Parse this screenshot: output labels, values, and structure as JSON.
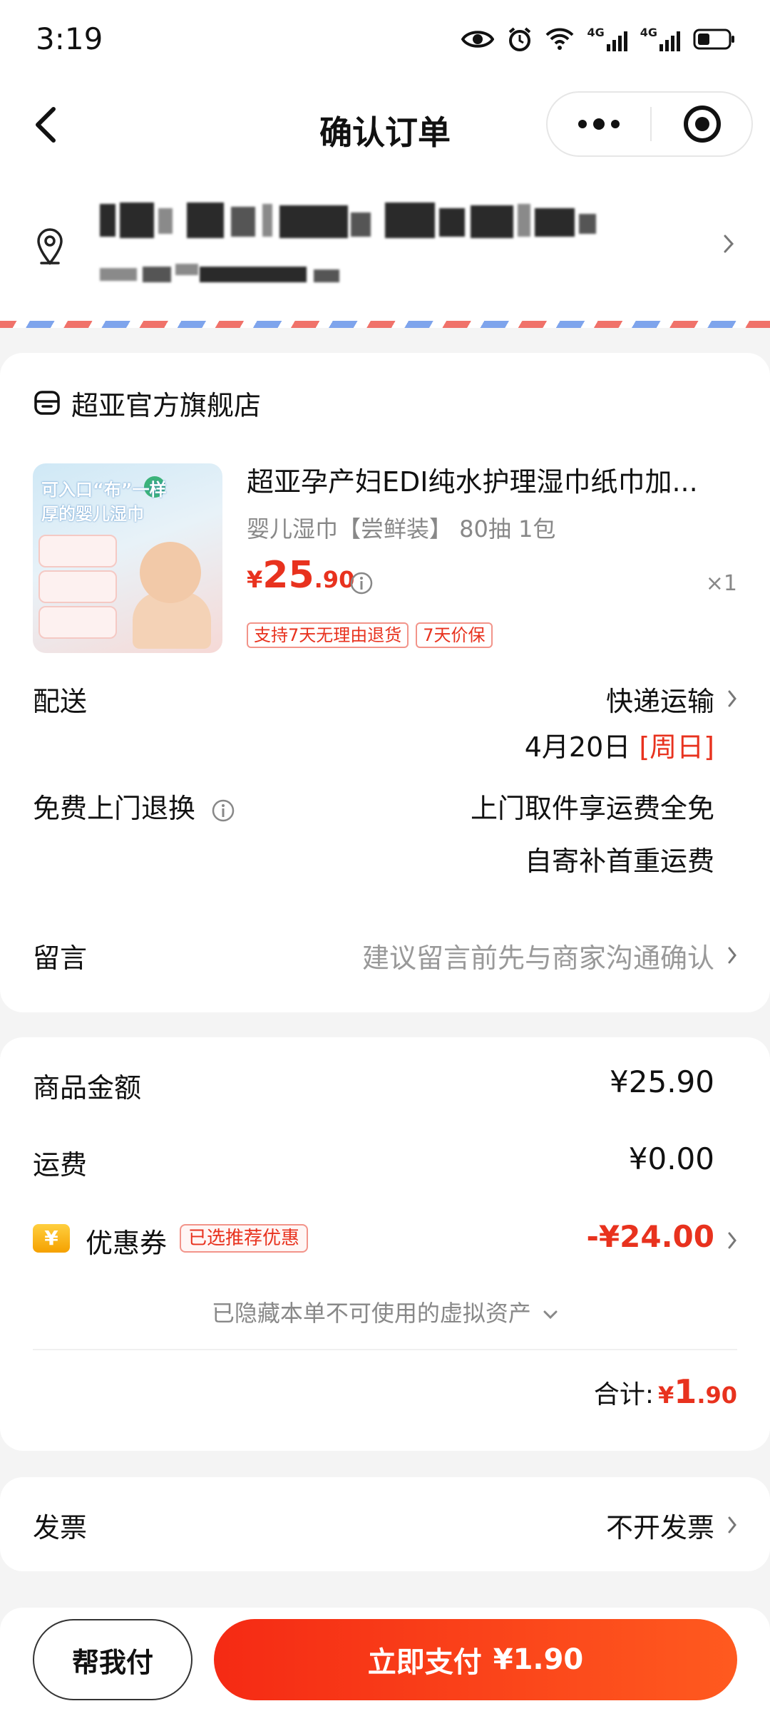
{
  "status_bar": {
    "time": "3:19",
    "net1": "4G",
    "net2": "4G"
  },
  "nav": {
    "title": "确认订单"
  },
  "shop": {
    "name": "超亚官方旗舰店"
  },
  "product": {
    "image_text_1": "可入口“布”一样",
    "image_text_2": "厚的婴儿湿巾",
    "title": "超亚孕产妇EDI纯水护理湿巾纸巾加...",
    "spec": "婴儿湿巾【尝鲜装】 80抽 1包",
    "price_yen": "¥",
    "price_int": "25",
    "price_dec": ".90",
    "qty": "×1",
    "tags": [
      "支持7天无理由退货",
      "7天价保"
    ]
  },
  "delivery": {
    "label": "配送",
    "method": "快递运输",
    "date": "4月20日",
    "weekday": "[周日]"
  },
  "return_service": {
    "label": "免费上门退换",
    "line1": "上门取件享运费全免",
    "line2": "自寄补首重运费"
  },
  "message": {
    "label": "留言",
    "placeholder": "建议留言前先与商家沟通确认"
  },
  "summary": {
    "goods_label": "商品金额",
    "goods_value": "¥25.90",
    "shipping_label": "运费",
    "shipping_value": "¥0.00",
    "coupon_icon": "¥",
    "coupon_label": "优惠券",
    "coupon_tag": "已选推荐优惠",
    "coupon_value": "-¥24.00",
    "hidden_assets": "已隐藏本单不可使用的虚拟资产",
    "total_label": "合计:",
    "total_yen": "¥",
    "total_int": "1",
    "total_dec": ".90"
  },
  "invoice": {
    "label": "发票",
    "value": "不开发票"
  },
  "bottom": {
    "help_label": "帮我付",
    "pay_label": "立即支付",
    "pay_amount": "¥1.90"
  },
  "colors": {
    "accent_red": "#e8321e",
    "pay_gradient_start": "#f52a14",
    "pay_gradient_end": "#ff5a1f"
  }
}
